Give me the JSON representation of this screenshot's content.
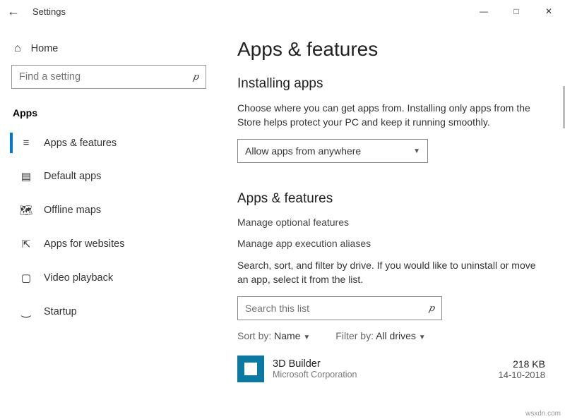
{
  "window": {
    "title": "Settings"
  },
  "sidebar": {
    "home": "Home",
    "search_placeholder": "Find a setting",
    "category": "Apps",
    "items": [
      {
        "label": "Apps & features"
      },
      {
        "label": "Default apps"
      },
      {
        "label": "Offline maps"
      },
      {
        "label": "Apps for websites"
      },
      {
        "label": "Video playback"
      },
      {
        "label": "Startup"
      }
    ]
  },
  "main": {
    "heading": "Apps & features",
    "installing": {
      "title": "Installing apps",
      "desc": "Choose where you can get apps from. Installing only apps from the Store helps protect your PC and keep it running smoothly.",
      "dropdown": "Allow apps from anywhere"
    },
    "features": {
      "title": "Apps & features",
      "link1": "Manage optional features",
      "link2": "Manage app execution aliases",
      "desc": "Search, sort, and filter by drive. If you would like to uninstall or move an app, select it from the list.",
      "search_placeholder": "Search this list",
      "sort_label": "Sort by:",
      "sort_value": "Name",
      "filter_label": "Filter by:",
      "filter_value": "All drives"
    },
    "apps": [
      {
        "name": "3D Builder",
        "publisher": "Microsoft Corporation",
        "size": "218 KB",
        "date": "14-10-2018"
      }
    ]
  },
  "watermark": "wsxdn.com"
}
